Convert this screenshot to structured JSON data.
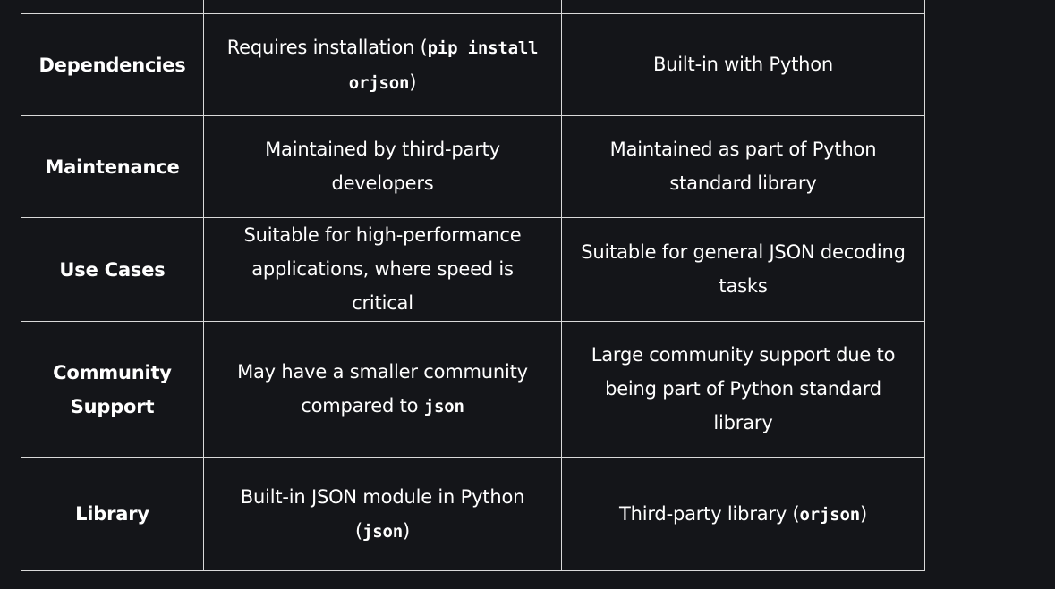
{
  "table": {
    "rows": [
      {
        "label": "Dependencies",
        "orjson_pre": "Requires installation (",
        "orjson_code": "pip install orjson",
        "orjson_post": ")",
        "json_pre": "Built-in with Python",
        "json_code": "",
        "json_post": ""
      },
      {
        "label": "Maintenance",
        "orjson_pre": "Maintained by third-party developers",
        "orjson_code": "",
        "orjson_post": "",
        "json_pre": "Maintained as part of Python standard library",
        "json_code": "",
        "json_post": ""
      },
      {
        "label": "Use Cases",
        "orjson_pre": "Suitable for high-performance applications, where speed is critical",
        "orjson_code": "",
        "orjson_post": "",
        "json_pre": "Suitable for general JSON decoding tasks",
        "json_code": "",
        "json_post": ""
      },
      {
        "label": "Community Support",
        "orjson_pre": "May have a smaller community compared to ",
        "orjson_code": "json",
        "orjson_post": "",
        "json_pre": "Large community support due to being part of Python standard library",
        "json_code": "",
        "json_post": ""
      },
      {
        "label": "Library",
        "orjson_pre": "Built-in JSON module in Python (",
        "orjson_code": "json",
        "orjson_post": ")",
        "json_pre": "Third-party library (",
        "json_code": "orjson",
        "json_post": ")"
      }
    ]
  }
}
